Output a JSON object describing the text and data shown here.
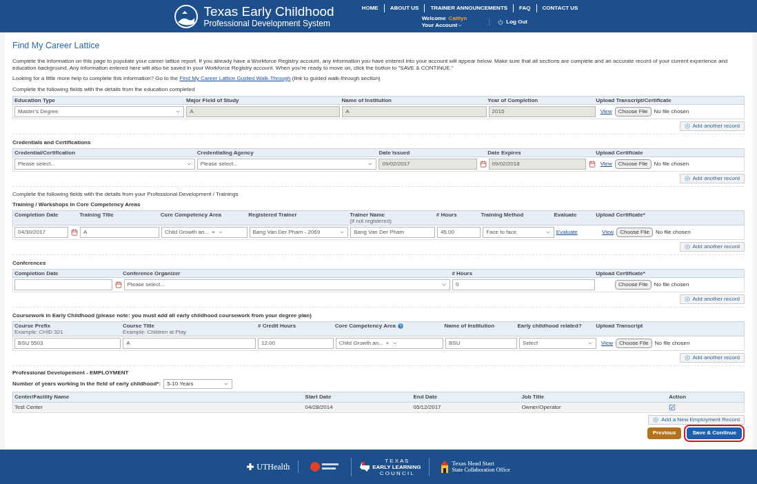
{
  "header": {
    "title": "Texas Early Childhood",
    "subtitle": "Professional Development System",
    "nav": [
      "HOME",
      "ABOUT US",
      "TRAINER ANNOUNCEMENTS",
      "FAQ",
      "CONTACT US"
    ],
    "welcome": "Welcome",
    "user": "Caitlyn",
    "account": "Your Account",
    "logout": "Log Out"
  },
  "page": {
    "title": "Find My Career Lattice",
    "intro": "Complete the information on this page to populate your career lattice report. If you already have a Workforce Registry account, any information you have entered into your account will appear below. Make sure that all sections are complete and an accurate record of your current experience and education background. Any information entered here will also be saved in your Workforce Registry account. When you're ready to move on, click the button to \"SAVE & CONTINUE.\"",
    "help_prefix": "Looking for a little more help to complete this information? Go to the",
    "help_link": "Find My Career Lattice Guided Walk-Through",
    "help_suffix": "(link to guided walk-through section)"
  },
  "sections": [
    {
      "note": "Complete the following fields with the details from the education completed",
      "columns": [
        {
          "label": "Education Type"
        },
        {
          "label": "Major Field of Study"
        },
        {
          "label": "Name of Institution"
        },
        {
          "label": "Year of Completion"
        },
        {
          "label": "Upload Transcript/Certificate"
        }
      ],
      "row": [
        {
          "kind": "select",
          "value": "Master's Degree"
        },
        {
          "kind": "input",
          "value": "A",
          "readonly": true
        },
        {
          "kind": "input",
          "value": "A",
          "readonly": true
        },
        {
          "kind": "input",
          "value": "2015",
          "readonly": true
        },
        {
          "kind": "upload",
          "view": "View",
          "button": "Choose File",
          "status": "No file chosen"
        }
      ],
      "add": "Add another record"
    },
    {
      "title": "Credentials and Certifications",
      "columns": [
        {
          "label": "Credential/Certification"
        },
        {
          "label": "Credentialing Agency"
        },
        {
          "label": "Date Issued"
        },
        {
          "label": "Date Expires"
        },
        {
          "label": "Upload Certificate"
        }
      ],
      "row": [
        {
          "kind": "select",
          "value": "Please select..."
        },
        {
          "kind": "select",
          "value": "Please select..."
        },
        {
          "kind": "date",
          "value": "09/02/2017",
          "readonly": true
        },
        {
          "kind": "date",
          "value": "09/02/2018",
          "readonly": true
        },
        {
          "kind": "upload",
          "view": "View",
          "button": "Choose File",
          "status": "No file chosen"
        }
      ],
      "add": "Add another record"
    },
    {
      "note": "Complete the following fields with the details from your Professional Development / Trainings",
      "title": "Training / Workshops in Core Competency Areas",
      "columns": [
        {
          "label": "Completion Date"
        },
        {
          "label": "Training Title"
        },
        {
          "label": "Core Competency Area"
        },
        {
          "label": "Registered Trainer"
        },
        {
          "label": "Trainer Name",
          "note": "(if not registered)"
        },
        {
          "label": "# Hours"
        },
        {
          "label": "Training Method"
        },
        {
          "label": "Evaluate"
        },
        {
          "label": "Upload Certificate*"
        }
      ],
      "row": [
        {
          "kind": "date",
          "value": "04/30/2017",
          "readonly": false
        },
        {
          "kind": "input",
          "value": "A",
          "readonly": false
        },
        {
          "kind": "multiselect",
          "value": "Child Growth an...",
          "clear": "×"
        },
        {
          "kind": "select",
          "value": "Bang Van Der Pham - 2069"
        },
        {
          "kind": "input",
          "value": "Bang Van Der Pham",
          "readonly": false
        },
        {
          "kind": "input",
          "value": "45.00",
          "readonly": false
        },
        {
          "kind": "select",
          "value": "Face to face"
        },
        {
          "kind": "link",
          "value": "Evaluate"
        },
        {
          "kind": "upload",
          "view": "View",
          "button": "Choose File",
          "status": "No file chosen"
        }
      ],
      "add": "Add another record"
    },
    {
      "title": "Conferences",
      "columns": [
        {
          "label": "Completion Date"
        },
        {
          "label": "Conference Organizer"
        },
        {
          "label": "# Hours"
        },
        {
          "label": "Upload Certificate*"
        }
      ],
      "row": [
        {
          "kind": "date",
          "readonly": false
        },
        {
          "kind": "select",
          "value": "Please select..."
        },
        {
          "kind": "input",
          "value": "0",
          "readonly": false
        },
        {
          "kind": "upload",
          "button": "Choose File",
          "status": "No file chosen"
        }
      ],
      "add": "Add another record"
    },
    {
      "title": "Coursework in Early Childhood (please note: you must add all early childhood coursework from your degree plan)",
      "columns": [
        {
          "label": "Course Prefix",
          "note": "Example: CHID 321"
        },
        {
          "label": "Course Title",
          "note": "Example: Children at Play"
        },
        {
          "label": "# Credit Hours"
        },
        {
          "label": "Core Competency Area",
          "help": true
        },
        {
          "label": "Name of Institution"
        },
        {
          "label": "Early childhood related?"
        },
        {
          "label": "Upload Transcript"
        }
      ],
      "row": [
        {
          "kind": "input",
          "value": "BSU 5503",
          "readonly": false
        },
        {
          "kind": "input",
          "value": "A",
          "readonly": false
        },
        {
          "kind": "input",
          "value": "12.00",
          "readonly": false
        },
        {
          "kind": "multiselect",
          "value": "Child Growth an...",
          "clear": "×"
        },
        {
          "kind": "input",
          "value": "BSU",
          "readonly": false
        },
        {
          "kind": "select",
          "value": "Select"
        },
        {
          "kind": "upload",
          "view": "View",
          "button": "Choose File",
          "status": "No file chosen"
        }
      ],
      "add": "Add another record"
    }
  ],
  "employment": {
    "title": "Professional Developement - EMPLOYMENT",
    "years_label": "Number of years working in the field of early childhood*:",
    "years_value": "5-10 Years",
    "columns": [
      "Center/Facility Name",
      "Start Date",
      "End Date",
      "Job Title",
      "Action"
    ],
    "rows": [
      [
        "Test Center",
        "04/28/2014",
        "05/12/2017",
        "Owner/Operator"
      ]
    ],
    "add": "Add a New Employment Record"
  },
  "actions": [
    {
      "label": "Previous",
      "kind": "secondary",
      "highlighted": false
    },
    {
      "label": "Save & Continue",
      "kind": "primary",
      "highlighted": true
    }
  ],
  "footer": {
    "uthealth": "UTHealth",
    "council_top": "T E X A S",
    "council_mid": "EARLY LEARNING",
    "council_bottom": "C O U N C I L",
    "headstart": "Texas Head Start",
    "headstart_sub": "State Collaboration Office"
  }
}
